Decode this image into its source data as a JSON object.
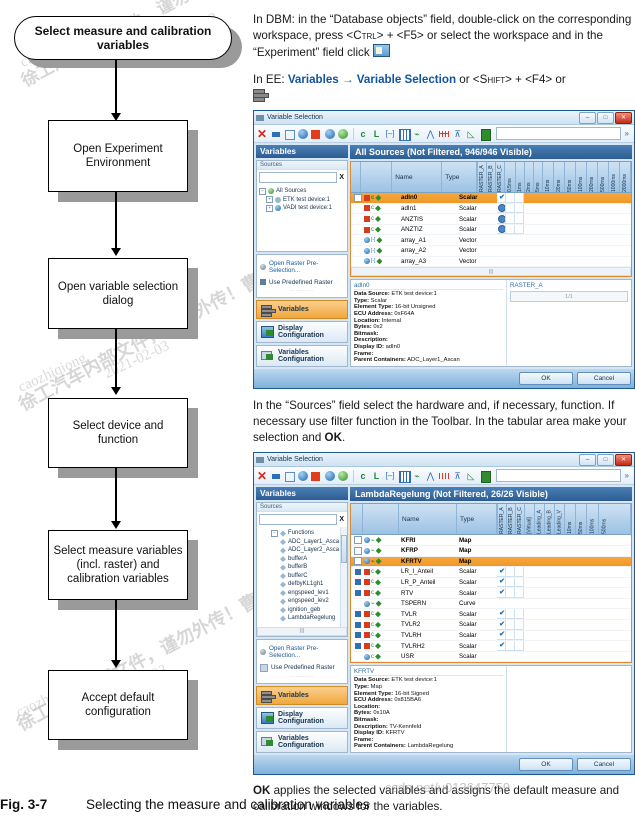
{
  "figure": {
    "number": "Fig. 3-7",
    "title": "Selecting the measure and calibration variables"
  },
  "flowchart": {
    "nodes": [
      {
        "label": "Select measure and calibration variables",
        "type": "terminator"
      },
      {
        "label": "Open Experiment Environment",
        "type": "process"
      },
      {
        "label": "Open variable selection dialog",
        "type": "process"
      },
      {
        "label": "Select device and function",
        "type": "process"
      },
      {
        "label": "Select measure variables (incl. raster) and calibration variables",
        "type": "process"
      },
      {
        "label": "Accept default configuration",
        "type": "process"
      }
    ]
  },
  "instructions": {
    "p1_a": "In DBM: in the “Database objects” field, double-click on the corresponding workspace, press <",
    "p1_ctrl": "Ctrl",
    "p1_b": "> + <",
    "p1_f5": "F5",
    "p1_c": "> or select the workspace and in the “Experiment” field click",
    "p2_a": "In EE:",
    "p2_menu1": "Variables",
    "p2_arrow": "→",
    "p2_menu2": "Variable Selection",
    "p2_b": "or <",
    "p2_shift": "Shift",
    "p2_c": "> + <",
    "p2_f4": "F4",
    "p2_d": "> or",
    "p3": "In the “Sources” field select the hardware and, if necessary, function. If necessary use filter function in the Toolbar. In the tabular area make your selection and ",
    "p3_ok": "OK",
    "p3_end": ".",
    "p4_ok": "OK",
    "p4": " applies the selected variables and assigns the default measure and calibration windows for the variables."
  },
  "dialog1": {
    "title": "Variable Selection",
    "window_buttons": {
      "minimize": "–",
      "maximize": "□",
      "close": "✕"
    },
    "toolbar": {
      "filter_value": "",
      "chevron": "»",
      "icons": [
        "delete-red-x-icon",
        "blue-square-icon",
        "empty-square-icon",
        "blue-sphere-icon",
        "red-square-icon",
        "curve-sphere-icon",
        "green-sphere-icon",
        "scalar-c-icon",
        "scalar-l-icon",
        "array-icon",
        "matrix-icon",
        "curve-icon",
        "map-icon",
        "raster-grid-icon",
        "axis-icon",
        "value-block-icon",
        "green-block-icon"
      ]
    },
    "variables_header": "Variables",
    "sources_label": "Sources",
    "sources_search_value": "",
    "sources_clear": "X",
    "tree": [
      {
        "label": "All Sources",
        "level": 0,
        "icon": "globe-icon"
      },
      {
        "label": "ETK test device:1",
        "level": 1,
        "icon": "device-icon"
      },
      {
        "label": "VADI test device:1",
        "level": 1,
        "icon": "device-icon"
      }
    ],
    "options": {
      "raster_link": "Open Raster Pre-Selection...",
      "predefined": "Use Predefined Raster"
    },
    "nav": [
      {
        "label": "Variables",
        "selected": true,
        "icon": "variables-icon"
      },
      {
        "label": "Display Configuration",
        "selected": false,
        "icon": "display-config-icon"
      },
      {
        "label": "Variables Configuration",
        "selected": false,
        "icon": "variables-config-icon"
      }
    ],
    "table_title": "All Sources (Not Filtered, 946/946 Visible)",
    "columns": {
      "name": "Name",
      "type": "Type"
    },
    "raster_columns": [
      "RASTER_A",
      "RASTER_B",
      "RASTER_C"
    ],
    "rate_columns": [
      "0.5ms",
      "1ms",
      "2ms",
      "5ms",
      "10ms",
      "20ms",
      "50ms",
      "100ms",
      "200ms",
      "500ms",
      "1000ms",
      "2000ms"
    ],
    "rows": [
      {
        "name": "adIn0",
        "type": "Scalar",
        "selected": true,
        "icon_color": "#d93b1f",
        "checks": [
          "check",
          "",
          ""
        ]
      },
      {
        "name": "adIn1",
        "type": "Scalar",
        "selected": false,
        "icon_color": "#d93b1f",
        "checks": [
          "dot",
          "",
          ""
        ]
      },
      {
        "name": "ANZTIS",
        "type": "Scalar",
        "selected": false,
        "icon_color": "#d93b1f",
        "checks": [
          "dot",
          "",
          ""
        ]
      },
      {
        "name": "ANZTIZ",
        "type": "Scalar",
        "selected": false,
        "icon_color": "#d93b1f",
        "checks": [
          "dot",
          "",
          ""
        ]
      },
      {
        "name": "array_A1",
        "type": "Vector",
        "selected": false,
        "icon_color": "#3b79c4",
        "checks": [
          "",
          "",
          ""
        ]
      },
      {
        "name": "array_A2",
        "type": "Vector",
        "selected": false,
        "icon_color": "#3b79c4",
        "checks": [
          "",
          "",
          ""
        ]
      },
      {
        "name": "array_A3",
        "type": "Vector",
        "selected": false,
        "icon_color": "#3b79c4",
        "checks": [
          "",
          "",
          ""
        ]
      }
    ],
    "detail": {
      "title": "adIn0",
      "lines": [
        {
          "k": "Data Source:",
          "v": " ETK test device:1"
        },
        {
          "k": "Type:",
          "v": " Scalar"
        },
        {
          "k": "Element Type:",
          "v": " 16-bit Unsigned"
        },
        {
          "k": "ECU Address:",
          "v": " 0xF64A"
        },
        {
          "k": "Location:",
          "v": " Internal"
        },
        {
          "k": "Bytes:",
          "v": " 0x2"
        },
        {
          "k": "Bitmask:",
          "v": ""
        },
        {
          "k": "Description:",
          "v": ""
        },
        {
          "k": "Display ID:",
          "v": " adIn0"
        },
        {
          "k": "Frame:",
          "v": ""
        },
        {
          "k": "Parent Containers:",
          "v": " ADC_Layer1_Ascan"
        }
      ],
      "raster_title": "RASTER_A",
      "raster_value": "1/1"
    },
    "buttons": {
      "ok": "OK",
      "cancel": "Cancel"
    }
  },
  "dialog2": {
    "title": "Variable Selection",
    "window_buttons": {
      "minimize": "–",
      "maximize": "□",
      "close": "✕"
    },
    "toolbar": {
      "filter_value": "",
      "chevron": "»"
    },
    "variables_header": "Variables",
    "sources_label": "Sources",
    "sources_search_value": "",
    "sources_clear": "X",
    "tree": [
      {
        "label": "Functions",
        "level": 0,
        "icon": "function-icon"
      },
      {
        "label": "ADC_Layer1_Asca",
        "level": 1,
        "icon": "function-icon"
      },
      {
        "label": "ADC_Layer2_Asca",
        "level": 1,
        "icon": "function-icon"
      },
      {
        "label": "bufferA",
        "level": 1,
        "icon": "function-icon"
      },
      {
        "label": "bufferB",
        "level": 1,
        "icon": "function-icon"
      },
      {
        "label": "bufferC",
        "level": 1,
        "icon": "function-icon"
      },
      {
        "label": "defbyKL1gh1",
        "level": 1,
        "icon": "function-icon"
      },
      {
        "label": "engspeed_lev1",
        "level": 1,
        "icon": "function-icon"
      },
      {
        "label": "engspeed_lev2",
        "level": 1,
        "icon": "function-icon"
      },
      {
        "label": "ignition_geb",
        "level": 1,
        "icon": "function-icon"
      },
      {
        "label": "LambdaRegelung",
        "level": 1,
        "icon": "function-icon"
      }
    ],
    "options": {
      "raster_link": "Open Raster Pre-Selection...",
      "predefined": "Use Predefined Raster"
    },
    "nav": [
      {
        "label": "Variables",
        "selected": true,
        "icon": "variables-icon"
      },
      {
        "label": "Display Configuration",
        "selected": false,
        "icon": "display-config-icon"
      },
      {
        "label": "Variables Configuration",
        "selected": false,
        "icon": "variables-config-icon"
      }
    ],
    "table_title": "LambdaRegelung (Not Filtered, 26/26 Visible)",
    "columns": {
      "name": "Name",
      "type": "Type"
    },
    "raster_columns": [
      "RASTER_A",
      "RASTER_B",
      "RASTER_C"
    ],
    "extra_columns": [
      "[Virtual]",
      "Leading_A",
      "Leading_B",
      "Leading_V"
    ],
    "rate_columns": [
      "10ms",
      "50ms",
      "100ms",
      "500ms"
    ],
    "rows": [
      {
        "name": "KFRI",
        "type": "Map",
        "selected": false,
        "icon_color": "#3b79c4",
        "bold": true,
        "checks": [
          "",
          "",
          ""
        ]
      },
      {
        "name": "KFRP",
        "type": "Map",
        "selected": false,
        "icon_color": "#3b79c4",
        "bold": true,
        "checks": [
          "",
          "",
          ""
        ]
      },
      {
        "name": "KFRTV",
        "type": "Map",
        "selected": true,
        "icon_color": "#3b79c4",
        "bold": true,
        "checks": [
          "",
          "",
          ""
        ]
      },
      {
        "name": "LR_I_Anteil",
        "type": "Scalar",
        "selected": false,
        "icon_color": "#d93b1f",
        "bold": false,
        "checks": [
          "check",
          "",
          ""
        ]
      },
      {
        "name": "LR_P_Anteil",
        "type": "Scalar",
        "selected": false,
        "icon_color": "#d93b1f",
        "bold": false,
        "checks": [
          "check",
          "",
          ""
        ]
      },
      {
        "name": "RTV",
        "type": "Scalar",
        "selected": false,
        "icon_color": "#d93b1f",
        "bold": false,
        "checks": [
          "check",
          "",
          ""
        ]
      },
      {
        "name": "TSPERN",
        "type": "Curve",
        "selected": false,
        "icon_color": "#3b79c4",
        "bold": false,
        "checks": [
          "",
          "",
          ""
        ]
      },
      {
        "name": "TVLR",
        "type": "Scalar",
        "selected": false,
        "icon_color": "#d93b1f",
        "bold": false,
        "checks": [
          "check",
          "",
          ""
        ]
      },
      {
        "name": "TVLR2",
        "type": "Scalar",
        "selected": false,
        "icon_color": "#d93b1f",
        "bold": false,
        "checks": [
          "check",
          "",
          ""
        ]
      },
      {
        "name": "TVLRH",
        "type": "Scalar",
        "selected": false,
        "icon_color": "#d93b1f",
        "bold": false,
        "checks": [
          "check",
          "",
          ""
        ]
      },
      {
        "name": "TVLRH2",
        "type": "Scalar",
        "selected": false,
        "icon_color": "#d93b1f",
        "bold": false,
        "checks": [
          "check",
          "",
          ""
        ]
      },
      {
        "name": "USR",
        "type": "Scalar",
        "selected": false,
        "icon_color": "#3b79c4",
        "bold": false,
        "checks": [
          "",
          "",
          ""
        ]
      }
    ],
    "detail": {
      "title": "KFRTV",
      "lines": [
        {
          "k": "Data Source:",
          "v": " ETK test device:1"
        },
        {
          "k": "Type:",
          "v": " Map"
        },
        {
          "k": "Element Type:",
          "v": " 16-bit Signed"
        },
        {
          "k": "ECU Address:",
          "v": " 0x815BA6"
        },
        {
          "k": "Location:",
          "v": ""
        },
        {
          "k": "Bytes:",
          "v": " 0x10A"
        },
        {
          "k": "Bitmask:",
          "v": ""
        },
        {
          "k": "Description:",
          "v": " TV-Kennfeld"
        },
        {
          "k": "Display ID:",
          "v": " KFRTV"
        },
        {
          "k": "Frame:",
          "v": ""
        },
        {
          "k": "Parent Containers:",
          "v": " LambdaRegelung"
        }
      ],
      "raster_title": "",
      "raster_value": ""
    },
    "buttons": {
      "ok": "OK",
      "cancel": "Cancel"
    }
  },
  "watermarks": {
    "a": "caozhiqiong",
    "b": "2021-02-03",
    "c": "csdn.net/u013647759"
  }
}
